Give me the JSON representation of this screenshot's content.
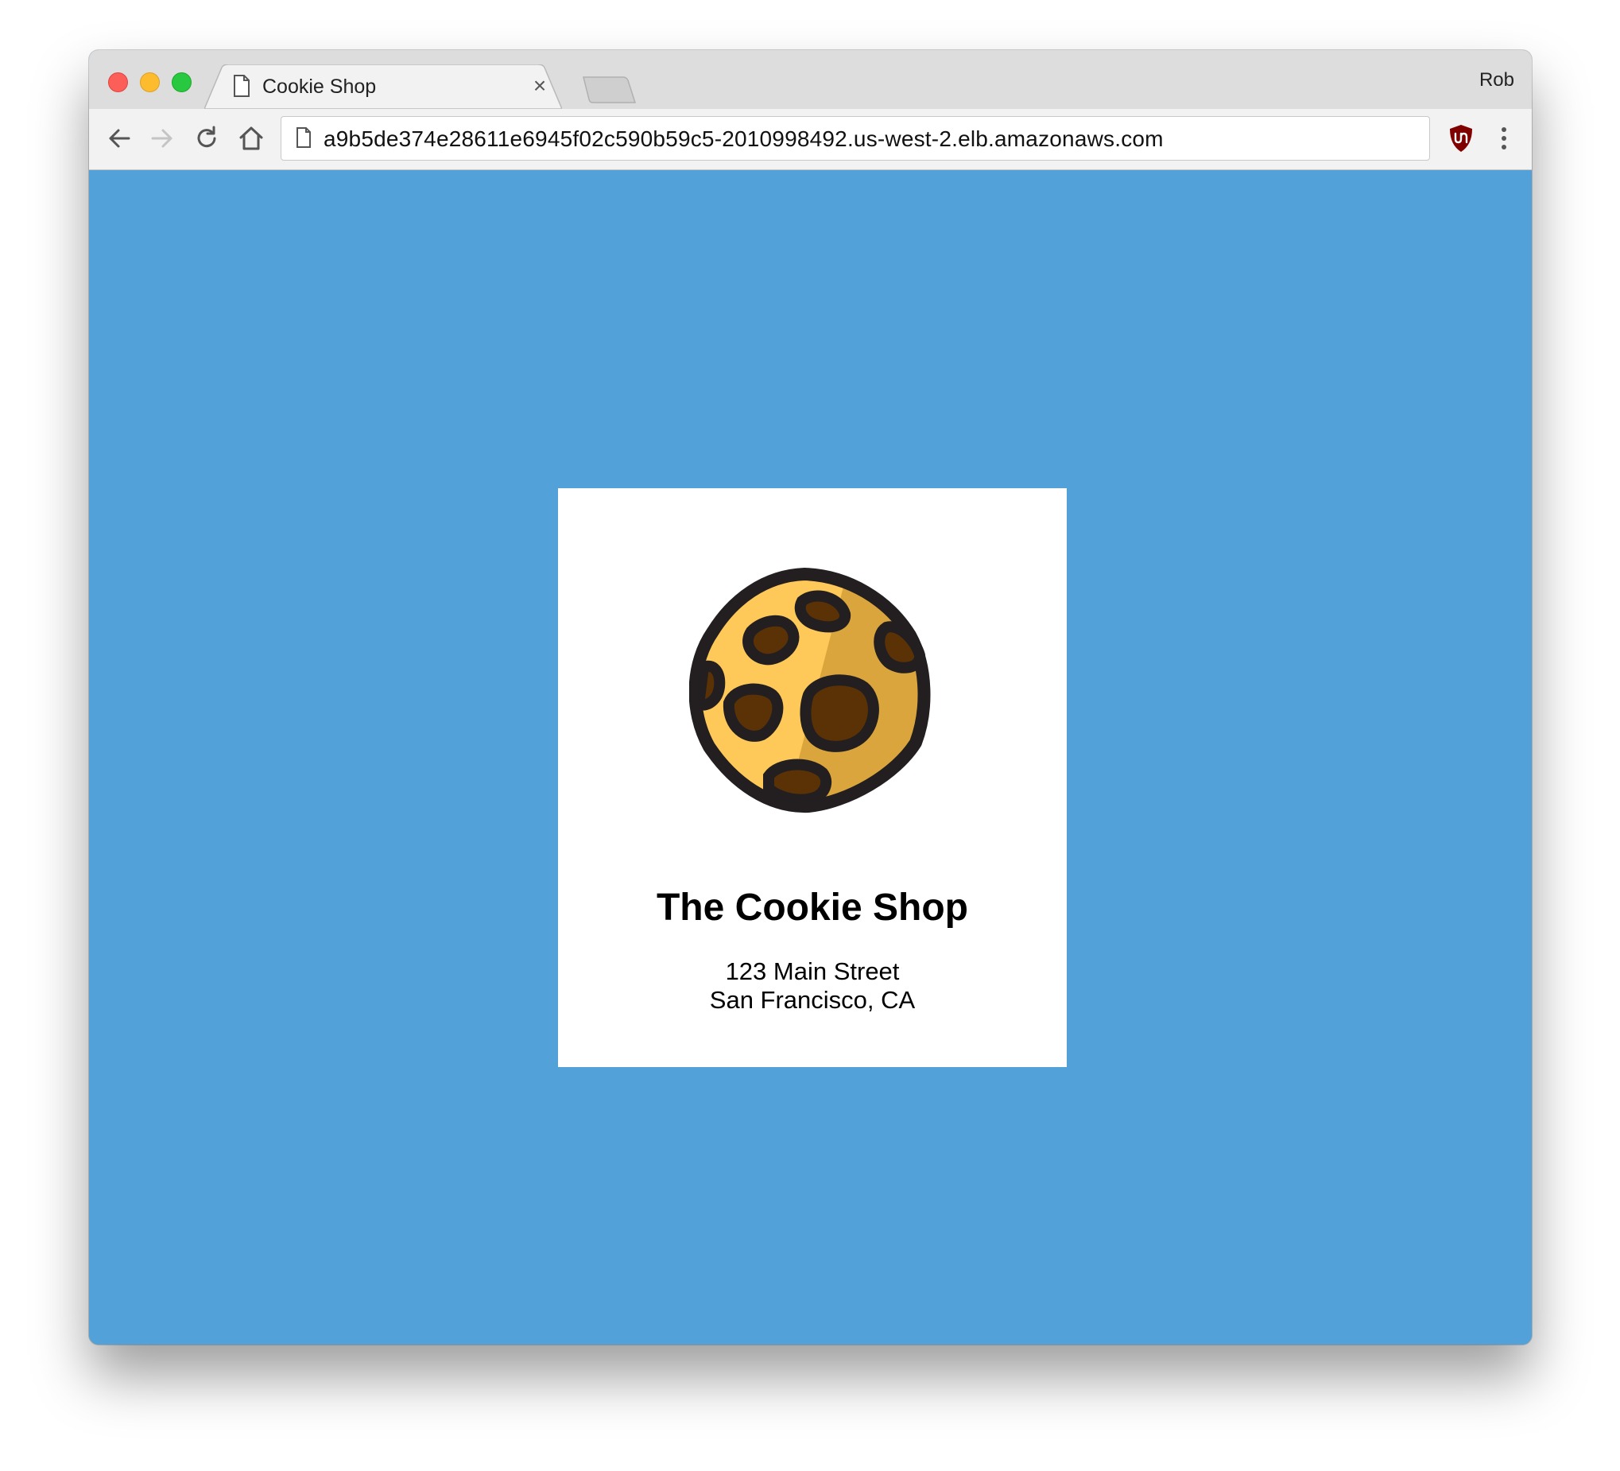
{
  "browser": {
    "tab": {
      "title": "Cookie Shop",
      "page_icon": "page-icon",
      "close_glyph": "×"
    },
    "profile_name": "Rob",
    "address_bar": {
      "url": "a9b5de374e28611e6945f02c590b59c5-2010998492.us-west-2.elb.amazonaws.com",
      "page_icon": "page-icon"
    },
    "toolbar_icons": [
      "back-arrow-icon",
      "forward-arrow-icon",
      "reload-icon",
      "home-icon"
    ],
    "extension_icon": "ublock-shield-icon",
    "menu_icon": "vertical-ellipsis-icon"
  },
  "page": {
    "background_color": "#52a2d9",
    "logo_icon": "cookie-icon",
    "shop_name": "The Cookie Shop",
    "address_line1": "123 Main Street",
    "address_line2": "San Francisco, CA"
  },
  "colors": {
    "traffic_close": "#fc5f57",
    "traffic_minimize": "#fdbc2e",
    "traffic_maximize": "#28c840",
    "cookie_light": "#fec958",
    "cookie_shade": "#d9a53c",
    "chocolate": "#5b3205",
    "outline": "#231f20",
    "ublock_red": "#800000"
  }
}
